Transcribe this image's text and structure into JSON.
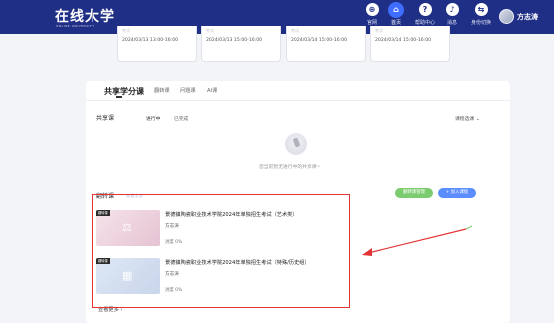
{
  "brand": {
    "logo": "在线大学",
    "sub": "ONLINE UNIVERSITY"
  },
  "nav": {
    "items": [
      {
        "label": "官网",
        "icon": "globe-icon",
        "glyph": "⊕"
      },
      {
        "label": "首页",
        "icon": "home-icon",
        "glyph": "⌂"
      },
      {
        "label": "帮助中心",
        "icon": "help-icon",
        "glyph": "?"
      },
      {
        "label": "消息",
        "icon": "bell-icon",
        "glyph": "♪"
      },
      {
        "label": "身份切换",
        "icon": "switch-icon",
        "glyph": "⇆"
      }
    ],
    "username": "方志涛"
  },
  "schedule": [
    {
      "top": "考试",
      "time": "2024/03/13 13:00-16:00"
    },
    {
      "top": "考试",
      "time": "2024/03/13 15:00-16:00"
    },
    {
      "top": "考试",
      "time": "2024/03/14 15:00-16:00"
    },
    {
      "top": "考试",
      "time": "2024/03/14 15:00-16:00"
    }
  ],
  "tabs": {
    "main": "共享学分课",
    "t1": "翻转课",
    "t2": "问题课",
    "t3": "AI课"
  },
  "shared": {
    "title": "共享课",
    "filter_active": "进行中",
    "filter_done": "已完成",
    "sort": "课程选课 ⌄",
    "empty_text": "您当前暂无进行中的共享课~"
  },
  "flip": {
    "title": "翻转课",
    "link": "查看全部",
    "btn_manage": "翻转课管理",
    "btn_join": "+ 加入课程"
  },
  "courses": [
    {
      "badge": "翻转课",
      "title": "景德镇陶瓷职业技术学院2024年单独招生考试（艺术类）",
      "teacher": "方志涛",
      "progress": "进度 0%",
      "glyph": "⚖"
    },
    {
      "badge": "翻转课",
      "title": "景德镇陶瓷职业技术学院2024年单独招生考试（特殊/历史组）",
      "teacher": "方志涛",
      "progress": "进度 0%",
      "glyph": "▦"
    }
  ],
  "more": "查看更多 ›",
  "colors": {
    "nav_bg": "#1f2f86",
    "accent": "#3f6dff",
    "annotation": "#e23434",
    "arrow": "#e23434"
  }
}
